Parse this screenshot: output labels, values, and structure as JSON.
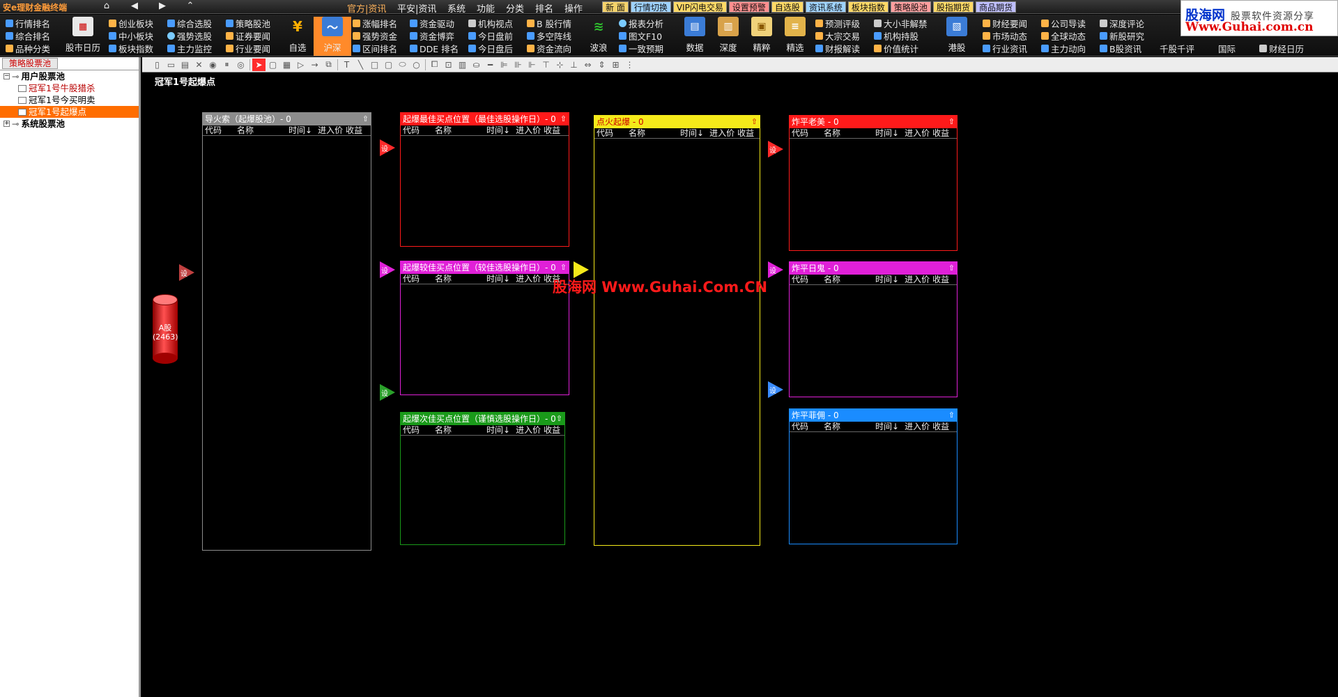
{
  "app": {
    "title": "安e理财金融终端"
  },
  "nav": {
    "home": "⌂",
    "back": "◀",
    "forward": "▶",
    "up": "⌃"
  },
  "menu": [
    {
      "label": "官方|资讯",
      "active": true
    },
    {
      "label": "平安|资讯"
    },
    {
      "label": "系统"
    },
    {
      "label": "功能"
    },
    {
      "label": "分类"
    },
    {
      "label": "排名"
    },
    {
      "label": "操作"
    }
  ],
  "func_tags": [
    {
      "label": "新 面",
      "color": "#f6d36b"
    },
    {
      "label": "行情切换",
      "color": "#9fd3ff"
    },
    {
      "label": "VIP闪电交易",
      "color": "#ffd966"
    },
    {
      "label": "设置预警",
      "color": "#ff8f8f"
    },
    {
      "label": "自选股",
      "color": "#ffd966"
    },
    {
      "label": "资讯系统",
      "color": "#9fd3ff"
    },
    {
      "label": "板块指数",
      "color": "#ffd966"
    },
    {
      "label": "策略股池",
      "color": "#ff9f9f"
    },
    {
      "label": "股指期货",
      "color": "#ffd966"
    },
    {
      "label": "商品期货",
      "color": "#bfbfff"
    }
  ],
  "toolbar": {
    "g1": [
      "行情排名",
      "综合排名",
      "品种分类"
    ],
    "stock_calendar": "股市日历",
    "g2": [
      "创业板块",
      "中小板块",
      "板块指数"
    ],
    "g3": [
      "综合选股",
      "强势选股",
      "主力监控"
    ],
    "g4": [
      "策略股池",
      "证券要闻",
      "行业要闻"
    ],
    "watchlist": "自选",
    "sh_sz": "沪深",
    "g5": [
      "涨幅排名",
      "强势资金",
      "区间排名"
    ],
    "g6": [
      "资金驱动",
      "资金博弈",
      "DDE 排名"
    ],
    "g7": [
      "机构视点",
      "今日盘前",
      "今日盘后"
    ],
    "g8": [
      "B 股行情",
      "多空阵线",
      "资金流向"
    ],
    "wave": "波浪",
    "g9": [
      "报表分析",
      "图文F10",
      "一致预期"
    ],
    "big2": [
      "数据",
      "深度",
      "精粹",
      "精选"
    ],
    "g10": [
      "预测评级",
      "大宗交易",
      "财报解读"
    ],
    "g11": [
      "大小非解禁",
      "机构持股",
      "价值统计"
    ],
    "hk": "港股",
    "g12": [
      "财经要闻",
      "市场动态",
      "行业资讯"
    ],
    "g13": [
      "公司导读",
      "全球动态",
      "主力动向"
    ],
    "g14": [
      "深度评论",
      "新股研究",
      "B股资讯"
    ],
    "tail": [
      "千股千评",
      "国际",
      "财经日历"
    ]
  },
  "brand": {
    "name": "股海网",
    "slogan": "股票软件资源分享",
    "url": "Www.Guhai.com.cn"
  },
  "sidebar": {
    "tab": "策略股票池",
    "tree": [
      {
        "label": "用户股票池",
        "expander": "−",
        "level": 0
      },
      {
        "label": "冠军1号牛股猎杀",
        "level": 1
      },
      {
        "label": "冠军1号今买明卖",
        "level": 1
      },
      {
        "label": "冠军1号起爆点",
        "level": 1,
        "selected": true
      },
      {
        "label": "系统股票池",
        "expander": "+",
        "level": 0
      }
    ]
  },
  "canvas": {
    "title": "冠军1号起爆点"
  },
  "columns": {
    "code": "代码",
    "name": "名称",
    "time": "时间↓",
    "price": "进入价",
    "profit": "收益"
  },
  "source": {
    "label": "A股",
    "count": "(2463)"
  },
  "flag_text": "设",
  "boxes": [
    {
      "id": "fuse",
      "title": "导火索（起爆股池）- 0",
      "color": "#8c8c8c"
    },
    {
      "id": "best",
      "title": "起爆最佳买点位置（最佳选股操作日）- 0",
      "color": "#ff1a1a"
    },
    {
      "id": "better",
      "title": "起爆较佳买点位置（较佳选股操作日）- 0",
      "color": "#e020d8"
    },
    {
      "id": "second",
      "title": "起爆次佳买点位置（谨慎选股操作日）- 0",
      "color": "#1a9a1a"
    },
    {
      "id": "ignite",
      "title": "点火起爆 - 0",
      "color": "#f5ea1a"
    },
    {
      "id": "laomei",
      "title": "炸平老美 - 0",
      "color": "#ff1a1a"
    },
    {
      "id": "riguo",
      "title": "炸平日鬼 - 0",
      "color": "#e020d8"
    },
    {
      "id": "feiyong",
      "title": "炸平菲佣 - 0",
      "color": "#1a8cff"
    }
  ],
  "watermark": "股海网 Www.Guhai.Com.CN"
}
